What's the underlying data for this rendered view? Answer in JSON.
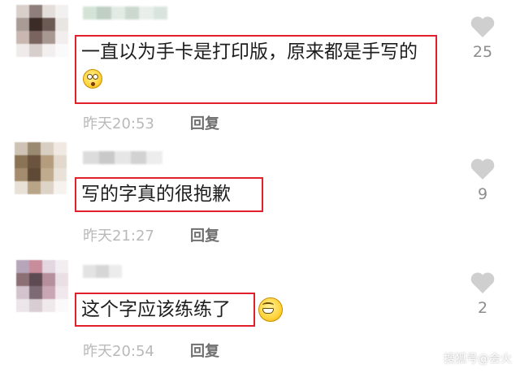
{
  "comments": [
    {
      "username": "",
      "text": "一直以为手卡是打印版，原来都是手写的",
      "emoji": "surprised-face-emoji",
      "time": "昨天20:53",
      "reply_label": "回复",
      "likes": "25",
      "avatar_colors": [
        "#d9d0cc",
        "#8e7f7a",
        "#e4dedb",
        "#f3f1f0",
        "#a99c96",
        "#3b2c28",
        "#6c5a55",
        "#e9e5e3",
        "#c9b8b2",
        "#7a6460",
        "#a89892",
        "#f1eeed",
        "#efebea",
        "#d6cfcc",
        "#f2efee",
        "#fafafa"
      ],
      "name_colors": [
        "#d3e3d6",
        "#bfcfc3",
        "#e3ebe5",
        "#cbd8ce",
        "#e8efe9",
        "#d9e5dc"
      ]
    },
    {
      "username": "",
      "text": "写的字真的很抱歉",
      "emoji": "",
      "time": "昨天21:27",
      "reply_label": "回复",
      "likes": "9",
      "avatar_colors": [
        "#cfc3b5",
        "#9b8a72",
        "#d8cfc2",
        "#efe9e2",
        "#8b7356",
        "#6a5440",
        "#b49c7c",
        "#e2d8cb",
        "#a58c6f",
        "#5e4a37",
        "#c0ab8f",
        "#e9e2d9",
        "#e8e1d8",
        "#b8a487",
        "#ddd3c6",
        "#f6f3ef"
      ],
      "name_colors": [
        "#dcdcdc",
        "#c9c9c9",
        "#e6e6e6",
        "#d2d2d2",
        "#ededed"
      ]
    },
    {
      "username": "",
      "text": "这个字应该练练了",
      "emoji": "grinning-face-emoji",
      "time": "昨天20:54",
      "reply_label": "回复",
      "likes": "2",
      "avatar_colors": [
        "#b7a6b9",
        "#c98c9b",
        "#e2d6e0",
        "#f2edf0",
        "#8d6f76",
        "#5d4a52",
        "#b58f9b",
        "#e9dfe5",
        "#d2c3cc",
        "#7e6a72",
        "#c9a6b3",
        "#f0e8ec",
        "#ece5e9",
        "#d8cdd3",
        "#efe9ec",
        "#fbf9fa"
      ],
      "name_colors": [
        "#e3e3e3",
        "#d6d6d6",
        "#ececec"
      ]
    }
  ],
  "watermark": "搜狐号@会火",
  "colors": {
    "highlight_border": "#e0202a",
    "meta_text": "#b9b9b9",
    "reply_text": "#6f6f6f",
    "like_icon": "#cfcfcf"
  }
}
